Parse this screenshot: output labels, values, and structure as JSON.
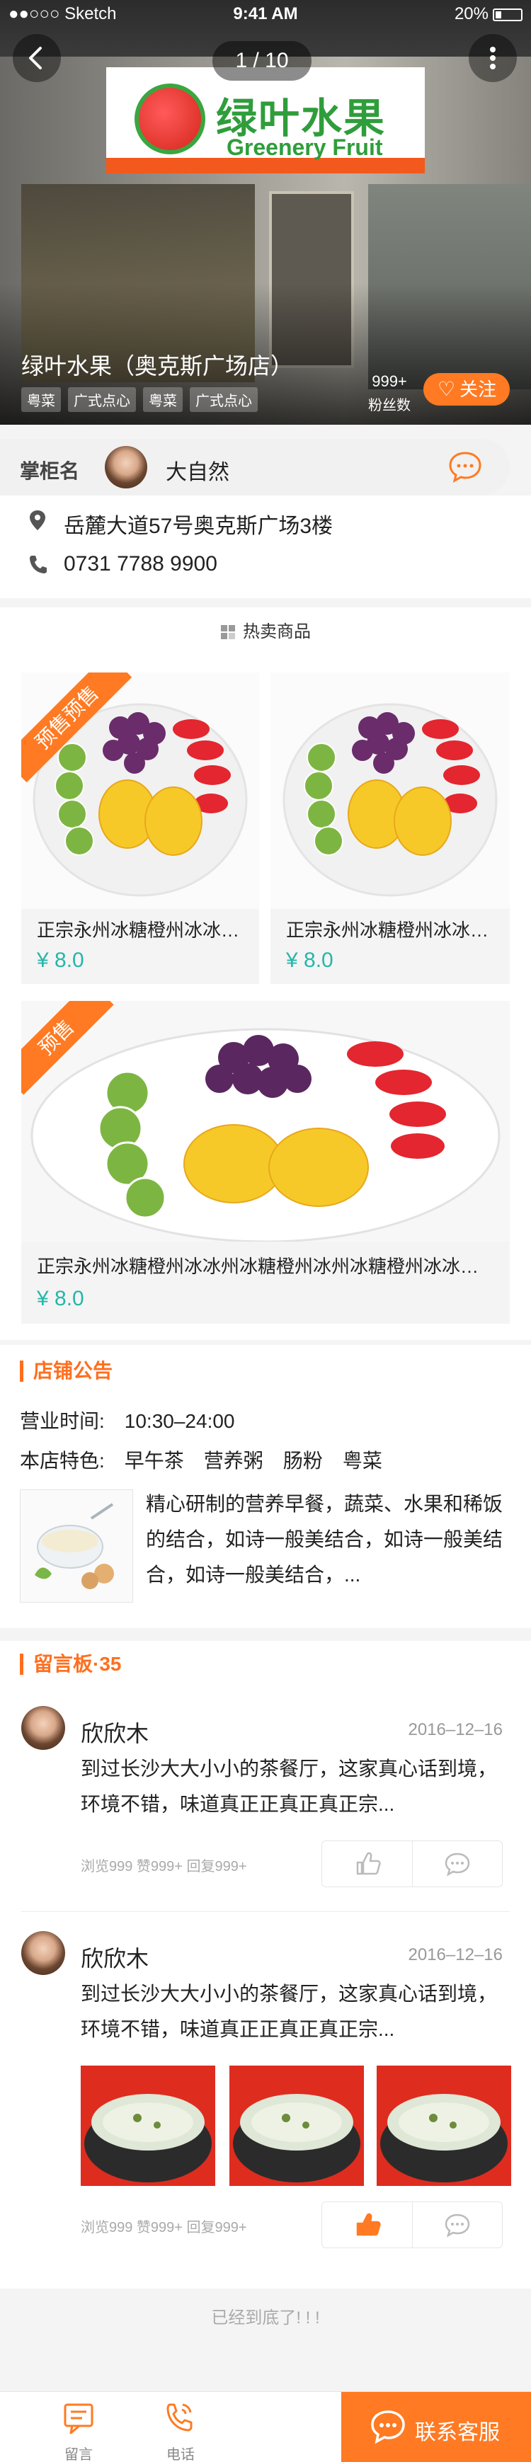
{
  "status_bar": {
    "carrier": "●●○○○ Sketch",
    "time": "9:41 AM",
    "battery": "20%"
  },
  "hero": {
    "pager": "1 / 10",
    "sign_cn": "绿叶水果",
    "sign_en": "Greenery Fruit",
    "store_name": "绿叶水果（奥克斯广场店）",
    "tags": [
      "粤菜",
      "广式点心",
      "粤菜",
      "广式点心"
    ],
    "fans_count": "999+",
    "fans_label": "粉丝数",
    "follow_label": "关注"
  },
  "keeper": {
    "label": "掌柜名",
    "name": "大自然"
  },
  "info": {
    "address": "岳麓大道57号奥克斯广场3楼",
    "phone": "0731 7788 9900"
  },
  "hot_goods": {
    "title": "热卖商品",
    "items": [
      {
        "name": "正宗永州冰糖橙州冰冰州冰糖橙州冰冰",
        "price": "¥ 8.0",
        "ribbon": "预售预售"
      },
      {
        "name": "正宗永州冰糖橙州冰冰州冰糖橙州冰冰",
        "price": "¥ 8.0",
        "ribbon": ""
      },
      {
        "name": "正宗永州冰糖橙州冰冰州冰糖橙州冰州冰糖橙州冰冰州冰糖橙州冰冰",
        "price": "¥ 8.0",
        "ribbon": "预售"
      }
    ]
  },
  "notice": {
    "title": "店铺公告",
    "hours_label": "营业时间:",
    "hours": "10:30–24:00",
    "features_label": "本店特色:",
    "features": [
      "早午茶",
      "营养粥",
      "肠粉",
      "粤菜"
    ],
    "description": "精心研制的营养早餐，蔬菜、水果和稀饭的结合，如诗一般美结合，如诗一般美结合，如诗一般美结合，..."
  },
  "messages": {
    "title": "留言板·35",
    "items": [
      {
        "name": "欣欣木",
        "date": "2016–12–16",
        "text": "到过长沙大大小小的茶餐厅，这家真心话到境，环境不错，味道真正正真正真正宗...",
        "stats": "浏览999  赞999+  回复999+",
        "liked": false
      },
      {
        "name": "欣欣木",
        "date": "2016–12–16",
        "text": "到过长沙大大小小的茶餐厅，这家真心话到境，环境不错，味道真正正真正真正宗...",
        "stats": "浏览999  赞999+  回复999+",
        "liked": true
      }
    ]
  },
  "end_text": "已经到底了! ! !",
  "bottom_bar": {
    "message_label": "留言",
    "phone_label": "电话",
    "contact_label": "联系客服"
  },
  "colors": {
    "accent": "#ff7a22",
    "price": "#27b6a8"
  }
}
